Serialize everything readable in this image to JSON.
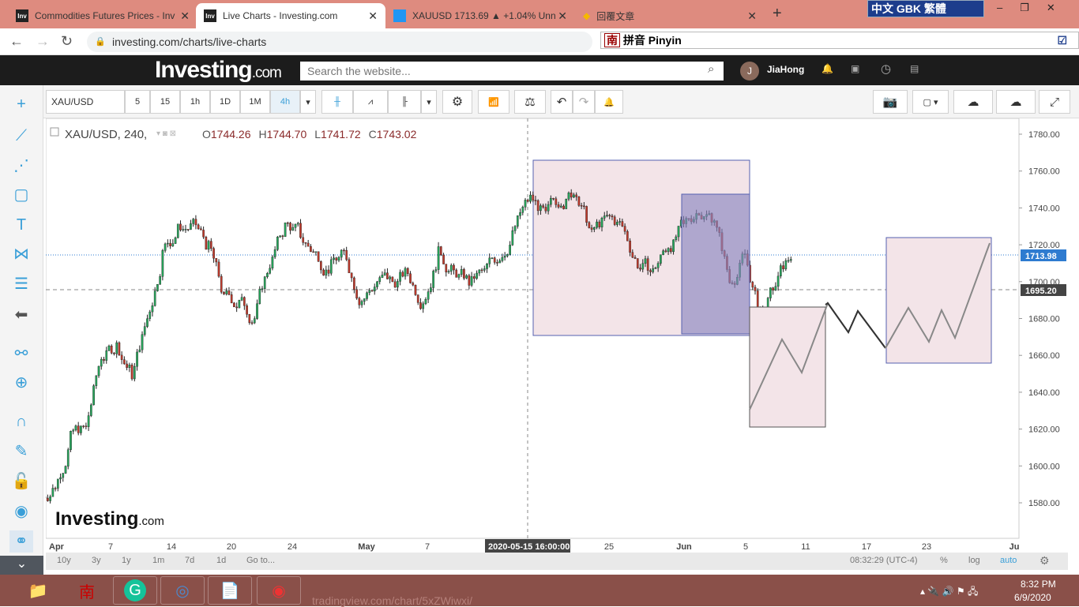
{
  "browser": {
    "tabs": [
      {
        "label": "Commodities Futures Prices - Inv",
        "icon": "Inv",
        "active": false
      },
      {
        "label": "Live Charts - Investing.com",
        "icon": "Inv",
        "active": true
      },
      {
        "label": "XAUUSD 1713.69 ▲ +1.04% Unn",
        "icon": "tradingview-icon",
        "active": false
      },
      {
        "label": "回覆文章",
        "icon": "diamond-icon",
        "active": false
      }
    ],
    "url": "investing.com/charts/live-charts",
    "ime_bar": "中文 GBK 繁體",
    "ime_mode": "拼音 Pinyin",
    "ime_logo": "南"
  },
  "site": {
    "logo": "Investing",
    "logo_suffix": ".com",
    "search_placeholder": "Search the website...",
    "user": "JiaHong",
    "avatar_letter": "J"
  },
  "toolbar": {
    "symbol": "XAU/USD",
    "intervals": [
      "5",
      "15",
      "1h",
      "1D",
      "1M",
      "4h"
    ],
    "active_interval": "4h"
  },
  "legend": {
    "title": "XAU/USD, 240,",
    "open_label": "O",
    "open": "1744.26",
    "high_label": "H",
    "high": "1744.70",
    "low_label": "L",
    "low": "1741.72",
    "close_label": "C",
    "close": "1743.02"
  },
  "watermark": {
    "text": "Investing",
    "suffix": ".com"
  },
  "price_labels": {
    "last": "1713.98",
    "crosshair": "1695.20",
    "last_color": "#2e7bd0"
  },
  "crosshair_date": "2020-05-15 16:00:00",
  "bottom": {
    "ranges": [
      "10y",
      "3y",
      "1y",
      "1m",
      "7d",
      "1d",
      "Go to..."
    ],
    "time": "08:32:29 (UTC-4)",
    "percent": "%",
    "log": "log",
    "auto": "auto"
  },
  "taskbar": {
    "time": "8:32 PM",
    "date": "6/9/2020",
    "peek_url": "tradingview.com/chart/5xZWiwxi/"
  },
  "chart_data": {
    "type": "candlestick",
    "symbol": "XAU/USD",
    "interval": "240",
    "ylim": [
      1565,
      1790
    ],
    "y_ticks": [
      1580,
      1600,
      1620,
      1640,
      1660,
      1680,
      1700,
      1720,
      1740,
      1760,
      1780
    ],
    "y_tick_labels": [
      "1580.00",
      "1600.00",
      "1620.00",
      "1640.00",
      "1660.00",
      "1680.00",
      "1700.00",
      "1720.00",
      "1740.00",
      "1760.00",
      "1780.00"
    ],
    "x_tick_labels": [
      "Apr",
      "7",
      "14",
      "20",
      "24",
      "May",
      "7",
      "25",
      "Jun",
      "5",
      "11",
      "17",
      "23",
      "Ju"
    ],
    "bullish_color": "#26a65b",
    "bearish_color": "#c0392b",
    "daily_closes": [
      [
        "2020-04-01",
        1590
      ],
      [
        "2020-04-02",
        1615
      ],
      [
        "2020-04-03",
        1620
      ],
      [
        "2020-04-06",
        1660
      ],
      [
        "2020-04-07",
        1665
      ],
      [
        "2020-04-08",
        1650
      ],
      [
        "2020-04-09",
        1680
      ],
      [
        "2020-04-13",
        1715
      ],
      [
        "2020-04-14",
        1728
      ],
      [
        "2020-04-15",
        1730
      ],
      [
        "2020-04-16",
        1718
      ],
      [
        "2020-04-17",
        1690
      ],
      [
        "2020-04-20",
        1688
      ],
      [
        "2020-04-21",
        1680
      ],
      [
        "2020-04-22",
        1710
      ],
      [
        "2020-04-23",
        1730
      ],
      [
        "2020-04-24",
        1726
      ],
      [
        "2020-04-27",
        1715
      ],
      [
        "2020-04-28",
        1708
      ],
      [
        "2020-04-29",
        1714
      ],
      [
        "2020-04-30",
        1690
      ],
      [
        "2020-05-01",
        1700
      ],
      [
        "2020-05-04",
        1700
      ],
      [
        "2020-05-05",
        1705
      ],
      [
        "2020-05-06",
        1690
      ],
      [
        "2020-05-07",
        1715
      ],
      [
        "2020-05-08",
        1705
      ],
      [
        "2020-05-11",
        1700
      ],
      [
        "2020-05-12",
        1705
      ],
      [
        "2020-05-13",
        1714
      ],
      [
        "2020-05-14",
        1730
      ],
      [
        "2020-05-15",
        1745
      ],
      [
        "2020-05-18",
        1735
      ],
      [
        "2020-05-19",
        1745
      ],
      [
        "2020-05-20",
        1750
      ],
      [
        "2020-05-21",
        1725
      ],
      [
        "2020-05-22",
        1734
      ],
      [
        "2020-05-25",
        1730
      ],
      [
        "2020-05-26",
        1710
      ],
      [
        "2020-05-27",
        1705
      ],
      [
        "2020-05-28",
        1720
      ],
      [
        "2020-05-29",
        1730
      ],
      [
        "2020-06-01",
        1740
      ],
      [
        "2020-06-02",
        1735
      ],
      [
        "2020-06-03",
        1700
      ],
      [
        "2020-06-04",
        1715
      ],
      [
        "2020-06-05",
        1680
      ],
      [
        "2020-06-08",
        1698
      ],
      [
        "2020-06-09",
        1714
      ]
    ]
  }
}
